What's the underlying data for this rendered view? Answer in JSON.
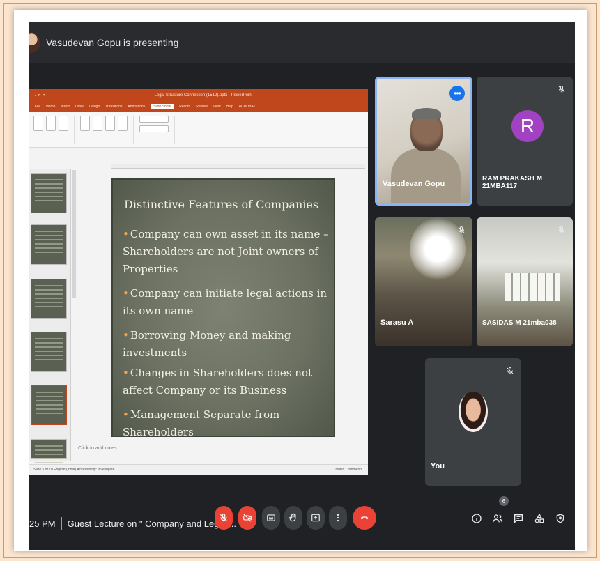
{
  "presenter": {
    "text": "Vasudevan Gopu is presenting"
  },
  "powerpoint": {
    "doc_title": "Legal Structure Connection (1512).pptx - PowerPoint",
    "tabs": [
      "File",
      "Home",
      "Insert",
      "Draw",
      "Design",
      "Transitions",
      "Animations",
      "Slide Show",
      "Record",
      "Review",
      "View",
      "Help",
      "ACROBAT"
    ],
    "active_tab": "Slide Show",
    "notes_placeholder": "Click to add notes",
    "status_left": "Slide 5 of 10   English (India)   Accessibility: Investigate",
    "status_right": "Notes   Comments"
  },
  "slide": {
    "title": "Distinctive Features of Companies",
    "bullets": [
      "Company can own asset in its name – Shareholders are not Joint  owners of Properties",
      "Company can initiate legal actions in its own name",
      "Borrowing Money and making investments",
      "Changes in Shareholders does not affect Company or its Business",
      "Management Separate from Shareholders"
    ]
  },
  "participants": {
    "vasudevan": {
      "name": "Vasudevan Gopu"
    },
    "ram": {
      "name": "RAM PRAKASH M 21MBA117",
      "initial": "R",
      "avatar_color": "#a142c3"
    },
    "sarasu": {
      "name": "Sarasu A"
    },
    "sasi": {
      "name": "SASIDAS M 21mba038"
    },
    "you": {
      "name": "You"
    }
  },
  "meeting": {
    "time": "25 PM",
    "title": "Guest Lecture on \" Company and Legal ..."
  },
  "people_count": "6",
  "colors": {
    "end_call": "#ea4335",
    "active_speaker": "#8ab4f8",
    "ppt_orange": "#c0461b"
  }
}
